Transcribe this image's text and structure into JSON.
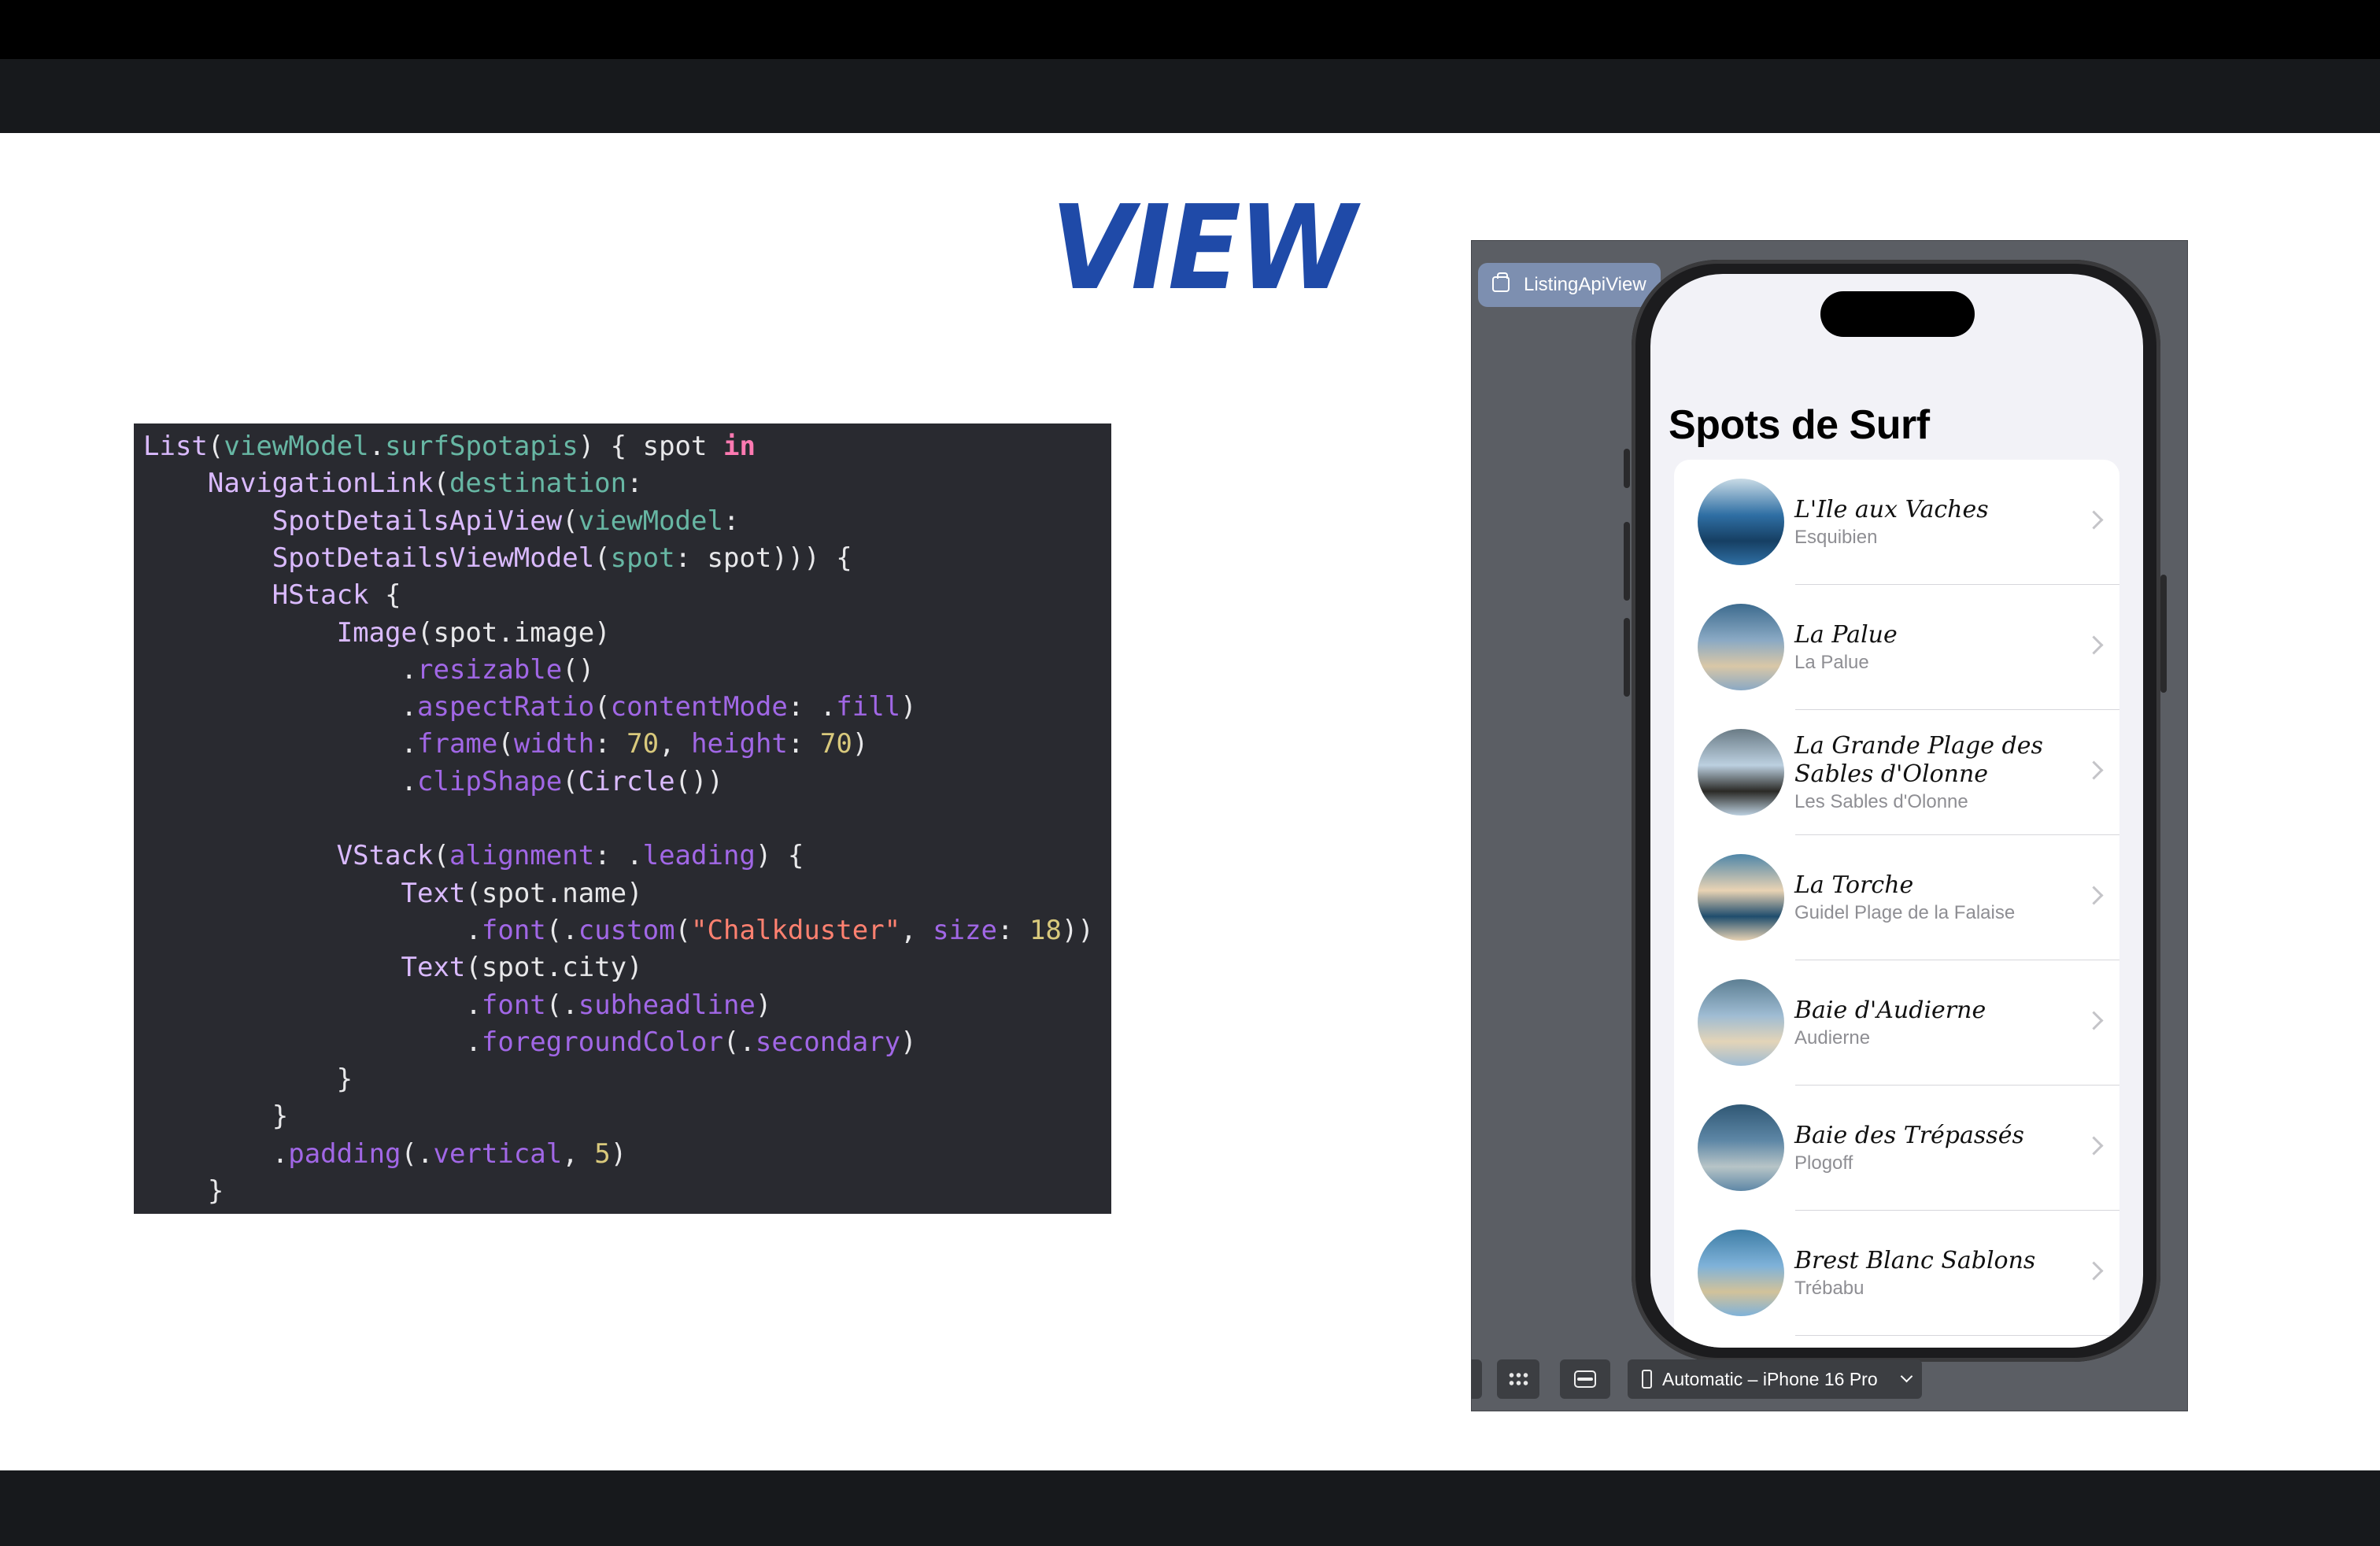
{
  "slide": {
    "title": "VIEW"
  },
  "code": {
    "lines": [
      [
        [
          "t-ty",
          "List"
        ],
        [
          "t-id",
          "("
        ],
        [
          "t-par",
          "viewModel"
        ],
        [
          "t-id",
          "."
        ],
        [
          "t-par",
          "surfSpotapis"
        ],
        [
          "t-id",
          ") { spot "
        ],
        [
          "t-kw",
          "in"
        ]
      ],
      [
        [
          "t-id",
          "    "
        ],
        [
          "t-ty",
          "NavigationLink"
        ],
        [
          "t-id",
          "("
        ],
        [
          "t-par",
          "destination"
        ],
        [
          "t-id",
          ":"
        ]
      ],
      [
        [
          "t-id",
          "        "
        ],
        [
          "t-ty",
          "SpotDetailsApiView"
        ],
        [
          "t-id",
          "("
        ],
        [
          "t-par",
          "viewModel"
        ],
        [
          "t-id",
          ":"
        ]
      ],
      [
        [
          "t-id",
          "        "
        ],
        [
          "t-ty",
          "SpotDetailsViewModel"
        ],
        [
          "t-id",
          "("
        ],
        [
          "t-par",
          "spot"
        ],
        [
          "t-id",
          ": spot))) {"
        ]
      ],
      [
        [
          "t-id",
          "        "
        ],
        [
          "t-ty",
          "HStack"
        ],
        [
          "t-id",
          " {"
        ]
      ],
      [
        [
          "t-id",
          "            "
        ],
        [
          "t-ty",
          "Image"
        ],
        [
          "t-id",
          "(spot.image)"
        ]
      ],
      [
        [
          "t-id",
          "                ."
        ],
        [
          "t-fn",
          "resizable"
        ],
        [
          "t-id",
          "()"
        ]
      ],
      [
        [
          "t-id",
          "                ."
        ],
        [
          "t-fn",
          "aspectRatio"
        ],
        [
          "t-id",
          "("
        ],
        [
          "t-fn",
          "contentMode"
        ],
        [
          "t-id",
          ": ."
        ],
        [
          "t-fn",
          "fill"
        ],
        [
          "t-id",
          ")"
        ]
      ],
      [
        [
          "t-id",
          "                ."
        ],
        [
          "t-fn",
          "frame"
        ],
        [
          "t-id",
          "("
        ],
        [
          "t-fn",
          "width"
        ],
        [
          "t-id",
          ": "
        ],
        [
          "t-num",
          "70"
        ],
        [
          "t-id",
          ", "
        ],
        [
          "t-fn",
          "height"
        ],
        [
          "t-id",
          ": "
        ],
        [
          "t-num",
          "70"
        ],
        [
          "t-id",
          ")"
        ]
      ],
      [
        [
          "t-id",
          "                ."
        ],
        [
          "t-fn",
          "clipShape"
        ],
        [
          "t-id",
          "("
        ],
        [
          "t-ty",
          "Circle"
        ],
        [
          "t-id",
          "())"
        ]
      ],
      [
        [
          "t-id",
          ""
        ]
      ],
      [
        [
          "t-id",
          "            "
        ],
        [
          "t-ty",
          "VStack"
        ],
        [
          "t-id",
          "("
        ],
        [
          "t-fn",
          "alignment"
        ],
        [
          "t-id",
          ": ."
        ],
        [
          "t-fn",
          "leading"
        ],
        [
          "t-id",
          ") {"
        ]
      ],
      [
        [
          "t-id",
          "                "
        ],
        [
          "t-ty",
          "Text"
        ],
        [
          "t-id",
          "(spot.name)"
        ]
      ],
      [
        [
          "t-id",
          "                    ."
        ],
        [
          "t-fn",
          "font"
        ],
        [
          "t-id",
          "(."
        ],
        [
          "t-fn",
          "custom"
        ],
        [
          "t-id",
          "("
        ],
        [
          "t-str",
          "\"Chalkduster\""
        ],
        [
          "t-id",
          ", "
        ],
        [
          "t-fn",
          "size"
        ],
        [
          "t-id",
          ": "
        ],
        [
          "t-num",
          "18"
        ],
        [
          "t-id",
          "))"
        ]
      ],
      [
        [
          "t-id",
          "                "
        ],
        [
          "t-ty",
          "Text"
        ],
        [
          "t-id",
          "(spot.city)"
        ]
      ],
      [
        [
          "t-id",
          "                    ."
        ],
        [
          "t-fn",
          "font"
        ],
        [
          "t-id",
          "(."
        ],
        [
          "t-fn",
          "subheadline"
        ],
        [
          "t-id",
          ")"
        ]
      ],
      [
        [
          "t-id",
          "                    ."
        ],
        [
          "t-fn",
          "foregroundColor"
        ],
        [
          "t-id",
          "(."
        ],
        [
          "t-fn",
          "secondary"
        ],
        [
          "t-id",
          ")"
        ]
      ],
      [
        [
          "t-id",
          "            }"
        ]
      ],
      [
        [
          "t-id",
          "        }"
        ]
      ],
      [
        [
          "t-id",
          "        ."
        ],
        [
          "t-fn",
          "padding"
        ],
        [
          "t-id",
          "(."
        ],
        [
          "t-fn",
          "vertical"
        ],
        [
          "t-id",
          ", "
        ],
        [
          "t-num",
          "5"
        ],
        [
          "t-id",
          ")"
        ]
      ],
      [
        [
          "t-id",
          "    }"
        ]
      ]
    ]
  },
  "preview": {
    "tab_label": "ListingApiView",
    "tab_icon": "canvas-icon",
    "nav_title": "Spots de Surf",
    "spots": [
      {
        "name": "L'Ile aux Vaches",
        "city": "Esquibien",
        "palette": [
          "#2f6fa4",
          "#c9dbe6",
          "#163f63"
        ]
      },
      {
        "name": "La Palue",
        "city": "La Palue",
        "palette": [
          "#8aa9c4",
          "#3d6b8e",
          "#d9c7a7"
        ]
      },
      {
        "name": "La Grande Plage des Sables d'Olonne",
        "city": "Les Sables d'Olonne",
        "palette": [
          "#bcd0e0",
          "#6a7b85",
          "#2b2a26"
        ]
      },
      {
        "name": "La Torche",
        "city": "Guidel Plage de la Falaise",
        "palette": [
          "#e9d3b4",
          "#4f86a8",
          "#1f4d6d"
        ]
      },
      {
        "name": "Baie d'Audierne",
        "city": "Audierne",
        "palette": [
          "#9fbcd3",
          "#5d7f93",
          "#e3d4b8"
        ]
      },
      {
        "name": "Baie des Trépassés",
        "city": "Plogoff",
        "palette": [
          "#5e87a6",
          "#2f5774",
          "#b7c4c7"
        ]
      },
      {
        "name": "Brest Blanc Sablons",
        "city": "Trébabu",
        "palette": [
          "#7fb2d9",
          "#3f7ea6",
          "#d2c29a"
        ]
      }
    ],
    "toolbar": {
      "device_label": "Automatic – iPhone 16 Pro",
      "icons": [
        "grid-icon",
        "variants-icon",
        "device-icon",
        "chevron-down-icon"
      ]
    }
  },
  "colors": {
    "title_blue": "#1f4aa8",
    "editor_bg": "#292a30",
    "canvas_bg": "#5b5e64"
  }
}
